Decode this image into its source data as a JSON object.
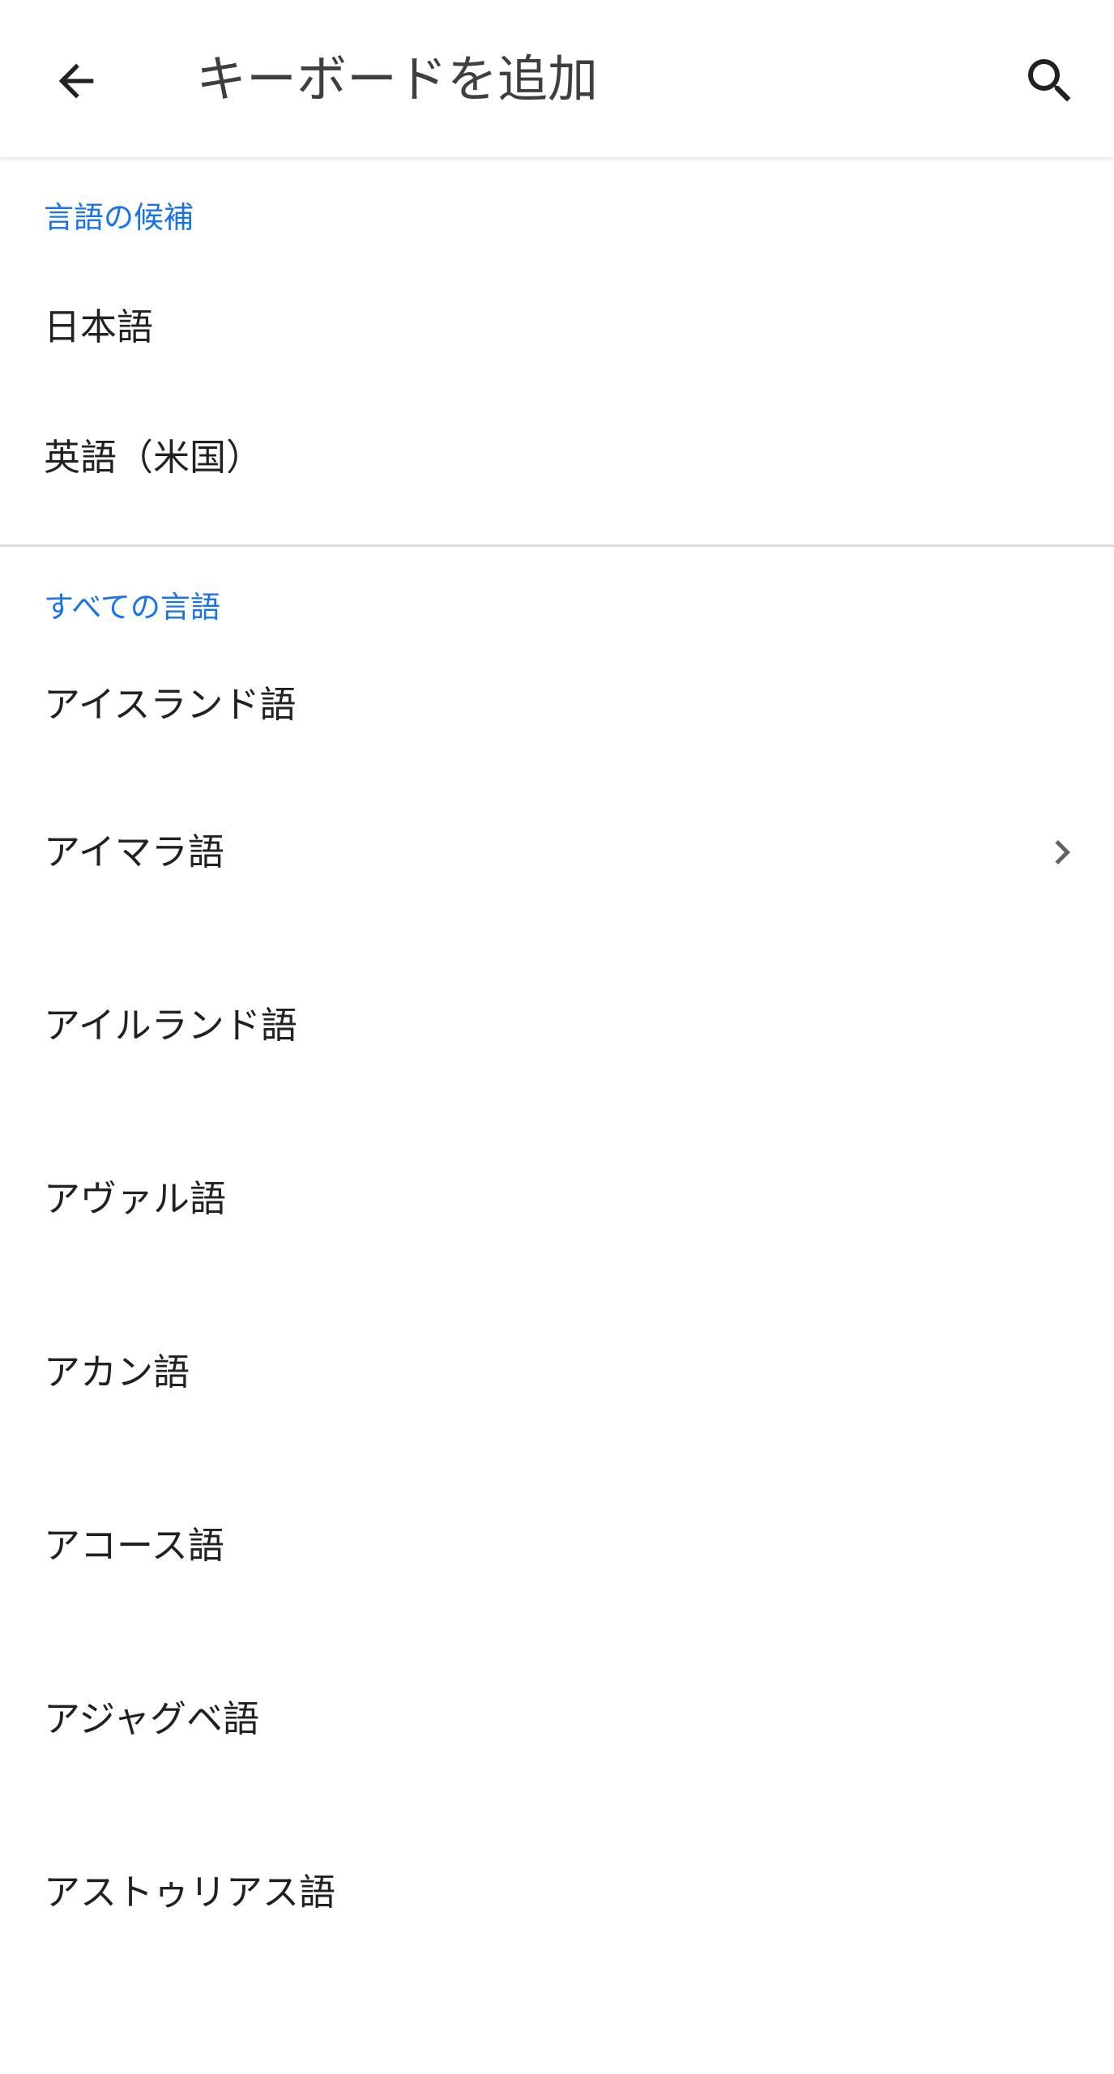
{
  "app_bar": {
    "title": "キーボードを追加",
    "back_icon": "arrow-back-icon",
    "search_icon": "search-icon"
  },
  "suggested": {
    "header": "言語の候補",
    "items": [
      {
        "label": "日本語"
      },
      {
        "label": "英語（米国）"
      }
    ]
  },
  "all": {
    "header": "すべての言語",
    "items": [
      {
        "label": "アイスランド語",
        "has_submenu": false
      },
      {
        "label": "アイマラ語",
        "has_submenu": true
      },
      {
        "label": "アイルランド語",
        "has_submenu": false
      },
      {
        "label": "アヴァル語",
        "has_submenu": false
      },
      {
        "label": "アカン語",
        "has_submenu": false
      },
      {
        "label": "アコース語",
        "has_submenu": false
      },
      {
        "label": "アジャグベ語",
        "has_submenu": false
      },
      {
        "label": "アストゥリアス語",
        "has_submenu": false
      }
    ]
  },
  "colors": {
    "accent": "#1a73e8",
    "text": "#202124",
    "divider": "#dcdcdc"
  }
}
